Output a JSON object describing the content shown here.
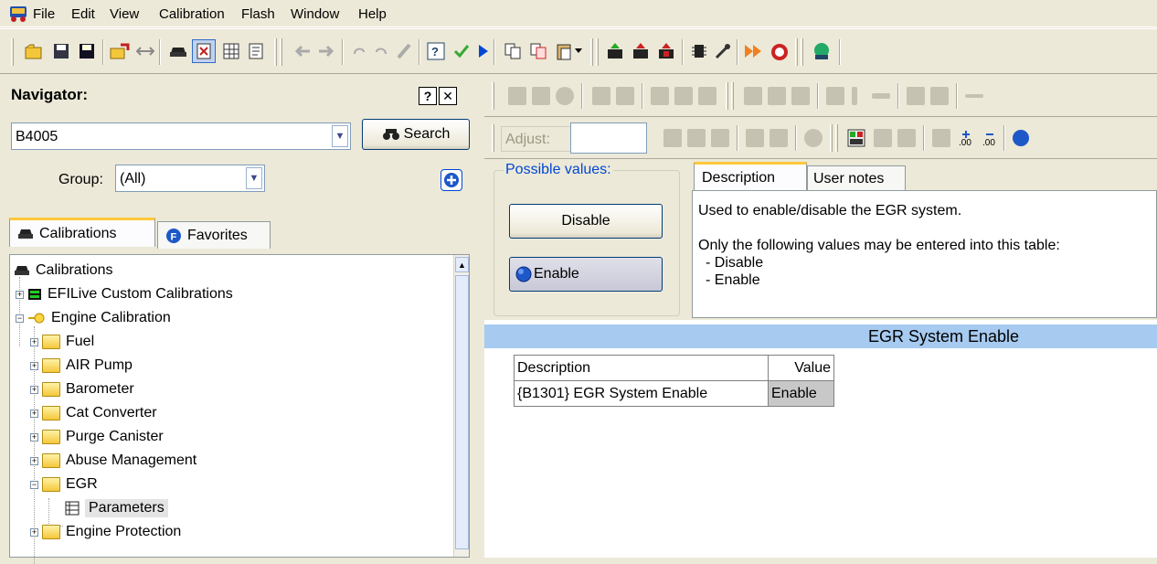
{
  "menubar": {
    "items": [
      "File",
      "Edit",
      "View",
      "Calibration",
      "Flash",
      "Window",
      "Help"
    ]
  },
  "navigator": {
    "title": "Navigator:",
    "help_label": "?",
    "close_label": "✕",
    "search_value": "B4005",
    "search_button_label": "Search",
    "group_label": "Group:",
    "group_value": "(All)"
  },
  "tabs": {
    "calibrations_label": "Calibrations",
    "favorites_label": "Favorites"
  },
  "tree": {
    "root": "Calibrations",
    "custom": "EFILive Custom Calibrations",
    "engine": "Engine Calibration",
    "folders": [
      "Fuel",
      "AIR Pump",
      "Barometer",
      "Cat Converter",
      "Purge Canister",
      "Abuse Management",
      "EGR"
    ],
    "selected_leaf": "Parameters",
    "last_folder": "Engine Protection"
  },
  "right_toolbar": {
    "adjust_label": "Adjust:",
    "adjust_value": ""
  },
  "possible_values": {
    "title": "Possible values:",
    "disable_label": "Disable",
    "enable_label": "Enable"
  },
  "description": {
    "tab_description": "Description",
    "tab_user_notes": "User notes",
    "line1": "Used to enable/disable the EGR system.",
    "line2": "Only the following values may be entered into this table:",
    "line3": "- Disable",
    "line4": "- Enable"
  },
  "grid": {
    "title": "EGR System Enable",
    "headers": [
      "Description",
      "Value"
    ],
    "rows": [
      [
        "{B1301} EGR System Enable",
        "Enable"
      ]
    ]
  },
  "colors": {
    "window_bg": "#ece9d8",
    "accent_blue": "#0046d5",
    "selection": "#316ac5",
    "grid_header": "#a6caf0"
  }
}
